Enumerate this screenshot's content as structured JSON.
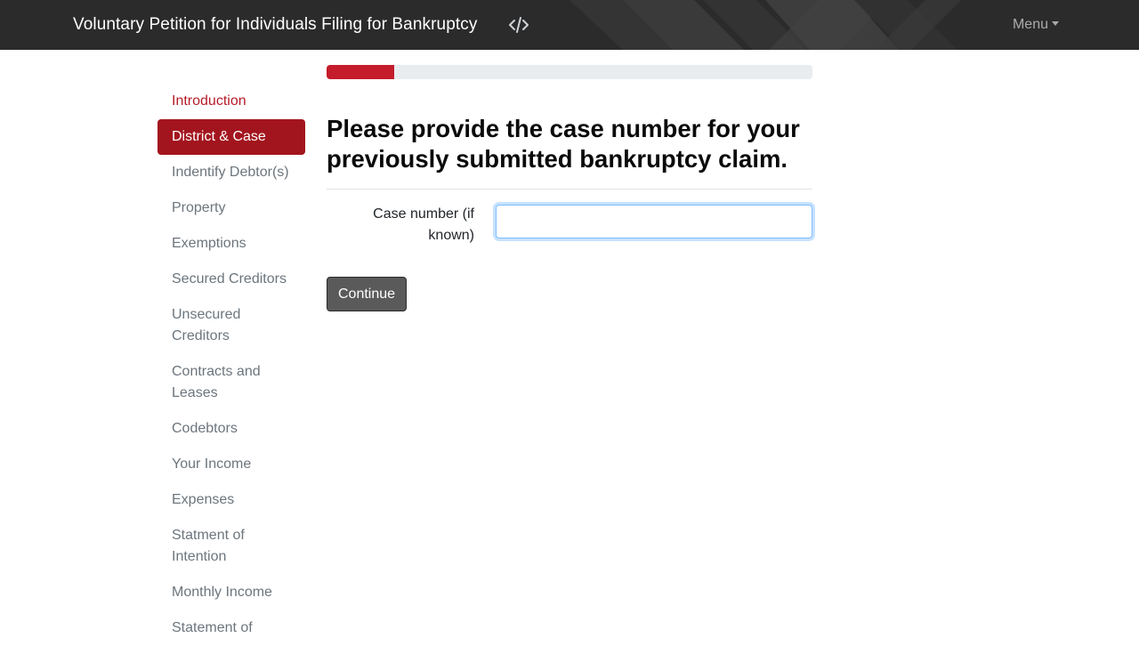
{
  "navbar": {
    "brand": "Voluntary Petition for Individuals Filing for Bankruptcy",
    "code_icon": "code-icon",
    "menu_label": "Menu"
  },
  "sidebar": {
    "items": [
      {
        "label": "Introduction",
        "state": "visited"
      },
      {
        "label": "District & Case",
        "state": "active"
      },
      {
        "label": "Indentify Debtor(s)",
        "state": "default"
      },
      {
        "label": "Property",
        "state": "default"
      },
      {
        "label": "Exemptions",
        "state": "default"
      },
      {
        "label": "Secured Creditors",
        "state": "default"
      },
      {
        "label": "Unsecured Creditors",
        "state": "default"
      },
      {
        "label": "Contracts and Leases",
        "state": "default"
      },
      {
        "label": "Codebtors",
        "state": "default"
      },
      {
        "label": "Your Income",
        "state": "default"
      },
      {
        "label": "Expenses",
        "state": "default"
      },
      {
        "label": "Statment of Intention",
        "state": "default"
      },
      {
        "label": "Monthly Income",
        "state": "default"
      },
      {
        "label": "Statement of",
        "state": "default"
      }
    ]
  },
  "main": {
    "progress": 0.14,
    "question": "Please provide the case number for your previously submitted bankruptcy claim.",
    "field_label": "Case number (if known)",
    "field_value": "",
    "continue_label": "Continue"
  },
  "colors": {
    "navbar": "#2b2b2b",
    "accent": "#a3151e",
    "progress": "#c41c2b",
    "button": "#5a5a5a"
  }
}
